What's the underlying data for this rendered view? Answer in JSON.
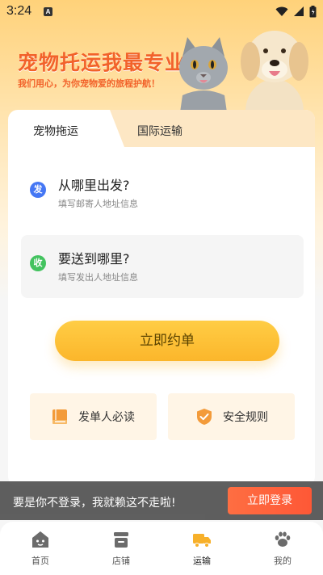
{
  "status": {
    "time": "3:24",
    "notif_letter": "A"
  },
  "hero": {
    "headline": "宠物托运我最专业！",
    "subline": "我们用心，为你宠物爱的旅程护航！"
  },
  "tabs": [
    {
      "label": "宠物拖运",
      "active": true
    },
    {
      "label": "国际运输",
      "active": false
    }
  ],
  "sender": {
    "badge": "发",
    "title": "从哪里出发?",
    "hint": "填写邮寄人地址信息"
  },
  "receiver": {
    "badge": "收",
    "title": "要送到哪里?",
    "hint": "填写发出人地址信息"
  },
  "book_button": "立即约单",
  "quick_links": [
    {
      "label": "发单人必读",
      "icon": "book-icon"
    },
    {
      "label": "安全规则",
      "icon": "shield-check-icon"
    }
  ],
  "login_banner": {
    "text": "要是你不登录，我就赖这不走啦!",
    "button": "立即登录"
  },
  "nav": [
    {
      "label": "首页",
      "icon": "home-icon",
      "active": false
    },
    {
      "label": "店铺",
      "icon": "store-icon",
      "active": false
    },
    {
      "label": "运输",
      "icon": "truck-icon",
      "active": true
    },
    {
      "label": "我的",
      "icon": "paw-icon",
      "active": false
    }
  ],
  "colors": {
    "accent": "#f2622a",
    "primary_button": "#fbb62b",
    "login_button": "#ff5a33",
    "nav_active": "#f7b02a",
    "nav_inactive": "#6b6b6b"
  }
}
